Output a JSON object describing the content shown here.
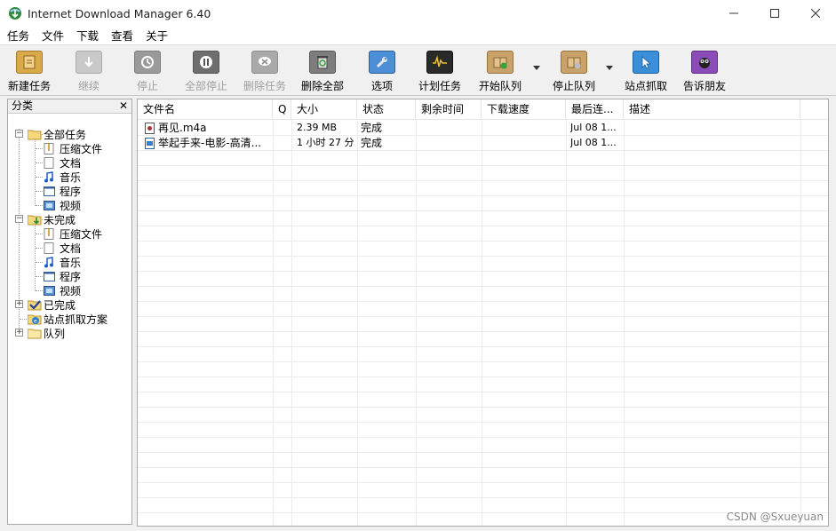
{
  "window": {
    "title": "Internet Download Manager 6.40",
    "minimize": "—",
    "maximize": "☐",
    "close": "✕"
  },
  "menu": [
    "任务",
    "文件",
    "下载",
    "查看",
    "关于"
  ],
  "toolbar": {
    "new_task": "新建任务",
    "resume": "继续",
    "stop": "停止",
    "stop_all": "全部停止",
    "delete_task": "删除任务",
    "delete_all": "删除全部",
    "options": "选项",
    "scheduler": "计划任务",
    "start_queue": "开始队列",
    "stop_queue": "停止队列",
    "grabber": "站点抓取",
    "tell_friend": "告诉朋友"
  },
  "categories": {
    "header": "分类",
    "close": "✕",
    "all": "全部任务",
    "unfinished": "未完成",
    "finished": "已完成",
    "grabber_projects": "站点抓取方案",
    "queues": "队列",
    "sub": {
      "compressed": "压缩文件",
      "documents": "文档",
      "music": "音乐",
      "programs": "程序",
      "video": "视频"
    }
  },
  "columns": {
    "name": "文件名",
    "q": "Q",
    "size": "大小",
    "status": "状态",
    "time_left": "剩余时间",
    "speed": "下载速度",
    "last_try": "最后连...",
    "description": "描述"
  },
  "files": [
    {
      "name": "再见.m4a",
      "size": "2.39  MB",
      "status": "完成",
      "last_try": "Jul 08 1..."
    },
    {
      "name": "举起手来-电影-高清...",
      "size": "1 小时 27 分",
      "status": "完成",
      "last_try": "Jul 08 1..."
    }
  ],
  "watermark": "CSDN @Sxueyuan"
}
